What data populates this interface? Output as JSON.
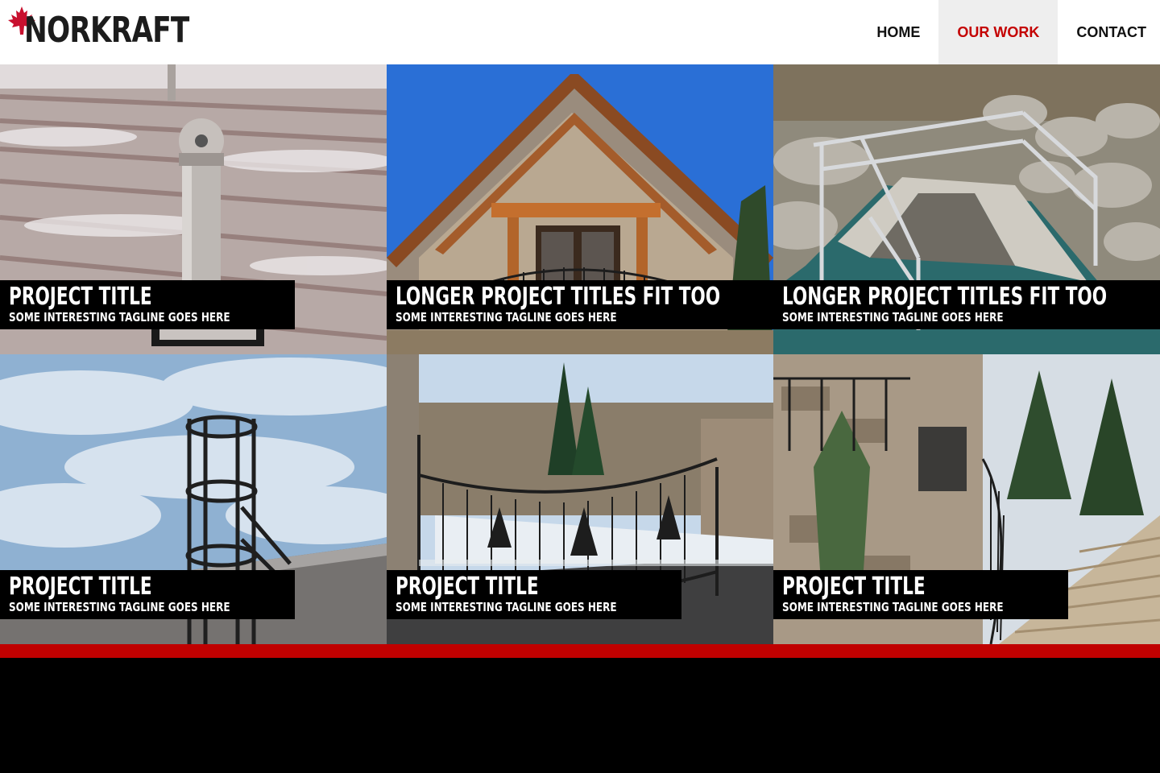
{
  "brand": {
    "name": "NORKRAFT",
    "leaf_color": "#c8102e"
  },
  "nav": {
    "items": [
      {
        "label": "HOME",
        "active": false
      },
      {
        "label": "OUR WORK",
        "active": true
      },
      {
        "label": "CONTACT",
        "active": false
      }
    ],
    "active_color": "#c40000"
  },
  "projects": [
    {
      "title": "PROJECT TITLE",
      "tagline": "SOME INTERESTING TAGLINE GOES HERE",
      "photo": "snowy-roof-post"
    },
    {
      "title": "LONGER PROJECT TITLES FIT TOO",
      "tagline": "SOME INTERESTING TAGLINE GOES HERE",
      "photo": "timber-gable-house"
    },
    {
      "title": "LONGER PROJECT TITLES FIT TOO",
      "tagline": "SOME INTERESTING TAGLINE GOES HERE",
      "photo": "railing-culvert-water"
    },
    {
      "title": "PROJECT TITLE",
      "tagline": "SOME INTERESTING TAGLINE GOES HERE",
      "photo": "caged-roof-ladder"
    },
    {
      "title": "PROJECT TITLE",
      "tagline": "SOME INTERESTING TAGLINE GOES HERE",
      "photo": "wrought-iron-gate"
    },
    {
      "title": "PROJECT TITLE",
      "tagline": "SOME INTERESTING TAGLINE GOES HERE",
      "photo": "curved-stair-railing"
    }
  ],
  "colors": {
    "accent_bar": "#c00000",
    "footer": "#000000"
  }
}
